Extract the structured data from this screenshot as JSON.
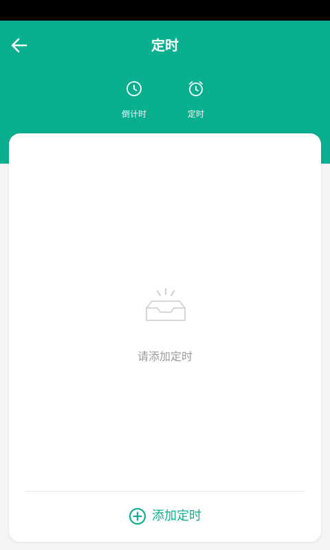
{
  "header": {
    "title": "定时",
    "background_color": "#0aaf8f",
    "back_icon": "arrow-left-icon"
  },
  "tabs": [
    {
      "label": "倒计时",
      "icon": "clock-icon"
    },
    {
      "label": "定时",
      "icon": "alarm-clock-icon"
    }
  ],
  "empty_state": {
    "icon": "empty-inbox-icon",
    "text": "请添加定时"
  },
  "footer": {
    "add_label": "添加定时",
    "add_icon": "plus-circle-icon",
    "accent_color": "#0aaf8f"
  }
}
